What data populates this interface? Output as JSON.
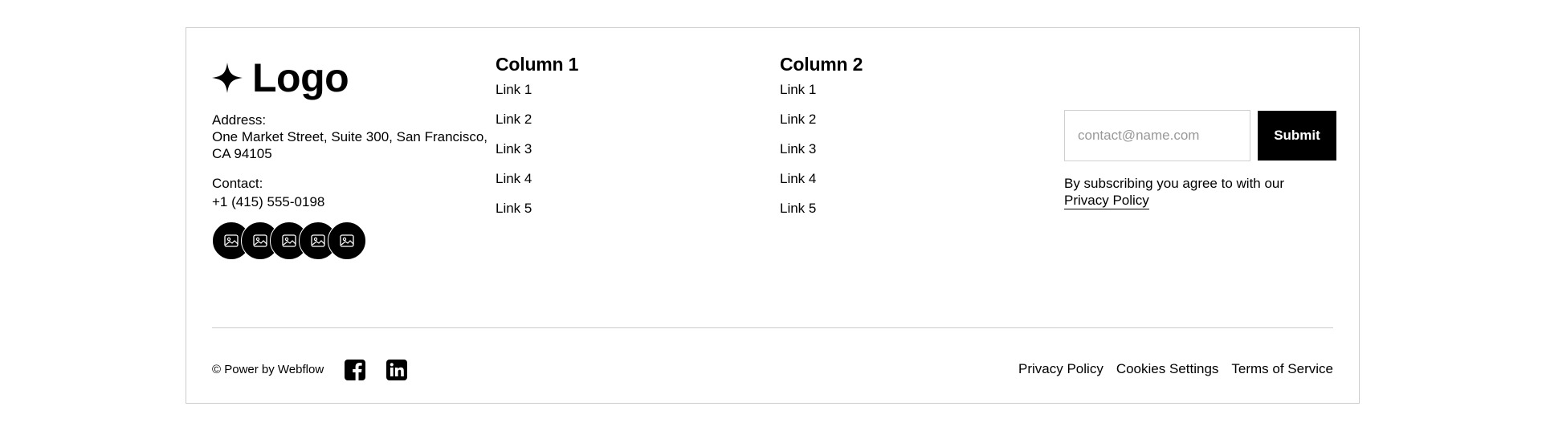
{
  "brand": {
    "logo_text": "Logo",
    "address_label": "Address:",
    "address_value": "One Market Street, Suite 300, San Francisco, CA 94105",
    "contact_label": "Contact:",
    "contact_value": "+1 (415) 555-0198",
    "social_icons": [
      "image-icon",
      "image-icon",
      "image-icon",
      "image-icon",
      "image-icon"
    ]
  },
  "columns": [
    {
      "title": "Column 1",
      "links": [
        "Link 1",
        "Link 2",
        "Link 3",
        "Link 4",
        "Link 5"
      ]
    },
    {
      "title": "Column 2",
      "links": [
        "Link 1",
        "Link 2",
        "Link 3",
        "Link 4",
        "Link 5"
      ]
    }
  ],
  "newsletter": {
    "placeholder": "contact@name.com",
    "submit_label": "Submit",
    "note": "By subscribing you agree to with our",
    "policy_link": "Privacy Policy"
  },
  "bottom": {
    "copyright": "© Power by Webflow",
    "social_icons": [
      "facebook-icon",
      "linkedin-icon"
    ],
    "legal_links": [
      "Privacy Policy",
      "Cookies Settings",
      "Terms of Service"
    ]
  },
  "colors": {
    "background": "#ffffff",
    "text": "#000000",
    "button": "#000000",
    "border": "#cccccc"
  }
}
